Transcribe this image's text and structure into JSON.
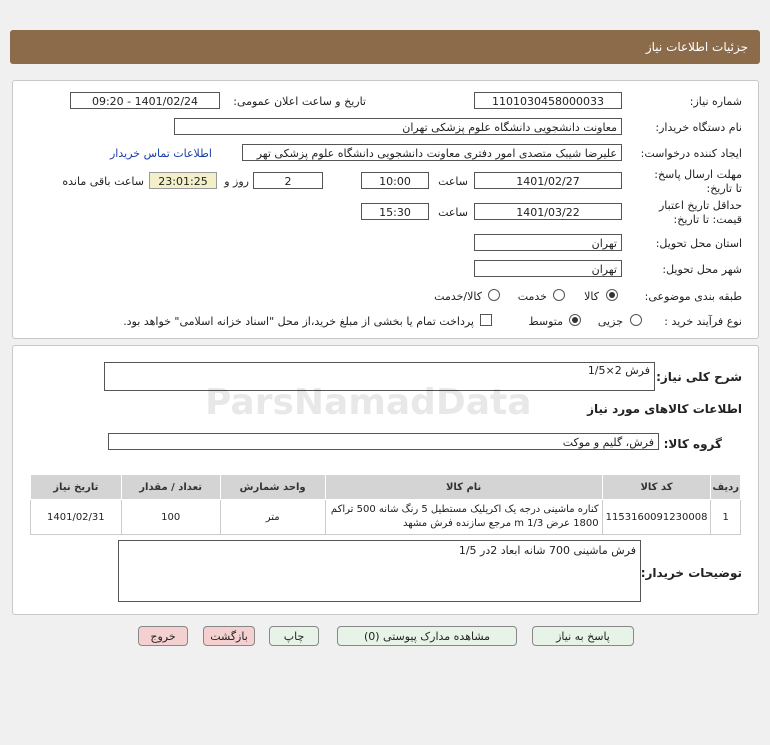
{
  "header": {
    "title": "جزئیات اطلاعات نیاز"
  },
  "details": {
    "need_number_label": "شماره نیاز:",
    "need_number": "1101030458000033",
    "announce_label": "تاریخ و ساعت اعلان عمومی:",
    "announce_value": "1401/02/24 - 09:20",
    "buyer_org_label": "نام دستگاه خریدار:",
    "buyer_org": "معاونت دانشجویی دانشگاه علوم پزشکی تهران",
    "requester_label": "ایجاد کننده درخواست:",
    "requester": "علیرضا شیبک متصدی امور دفتری معاونت دانشجویی دانشگاه علوم پزشکی تهر",
    "contact_link": "اطلاعات تماس خریدار",
    "deadline_label": "مهلت ارسال پاسخ: تا تاریخ:",
    "deadline_date": "1401/02/27",
    "time_label": "ساعت",
    "deadline_time": "10:00",
    "days_value": "2",
    "days_label": "روز و",
    "remaining_time": "23:01:25",
    "remaining_label": "ساعت باقی مانده",
    "validity_label": "حداقل تاریخ اعتبار قیمت: تا تاریخ:",
    "validity_date": "1401/03/22",
    "validity_time": "15:30",
    "province_label": "استان محل تحویل:",
    "province": "تهران",
    "city_label": "شهر محل تحویل:",
    "city": "تهران",
    "category_label": "طبقه بندی موضوعی:",
    "category_options": [
      "کالا",
      "خدمت",
      "کالا/خدمت"
    ],
    "process_label": "نوع فرآیند خرید :",
    "process_options": [
      "جزیی",
      "متوسط"
    ],
    "payment_note": "پرداخت تمام یا بخشی از مبلغ خرید،از محل \"اسناد خزانه اسلامی\" خواهد بود."
  },
  "summary": {
    "desc_label": "شرح کلی نیاز:",
    "desc_value": "فرش 2×1/5",
    "goods_info_title": "اطلاعات کالاهای مورد نیاز",
    "group_label": "گروه کالا:",
    "group_value": "فرش، گلیم و موکت"
  },
  "table": {
    "headers": [
      "ردیف",
      "کد کالا",
      "نام کالا",
      "واحد شمارش",
      "تعداد / مقدار",
      "تاریخ نیاز"
    ],
    "rows": [
      {
        "row": "1",
        "code": "1153160091230008",
        "name": "کناره ماشینی درجه یک اکریلیک مستطیل 5 رنگ شانه 500 تراکم 1800 عرض m 1/3 مرجع سازنده فرش مشهد",
        "unit": "متر",
        "qty": "100",
        "date": "1401/02/31"
      }
    ]
  },
  "buyer_desc": {
    "label": "توضیحات خریدار:",
    "value": "فرش ماشینی 700 شانه ابعاد 2در 1/5"
  },
  "buttons": {
    "reply": "پاسخ به نیاز",
    "attachments": "مشاهده مدارک پیوستی (0)",
    "print": "چاپ",
    "back": "بازگشت",
    "exit": "خروج"
  },
  "watermark": {
    "brand": "ParsNamadData"
  },
  "colors": {
    "titlebar": "#8b6b4a",
    "timer_bg": "#f3efc8",
    "btn_green": "#e8f3e8",
    "btn_red": "#f4d0d0"
  }
}
